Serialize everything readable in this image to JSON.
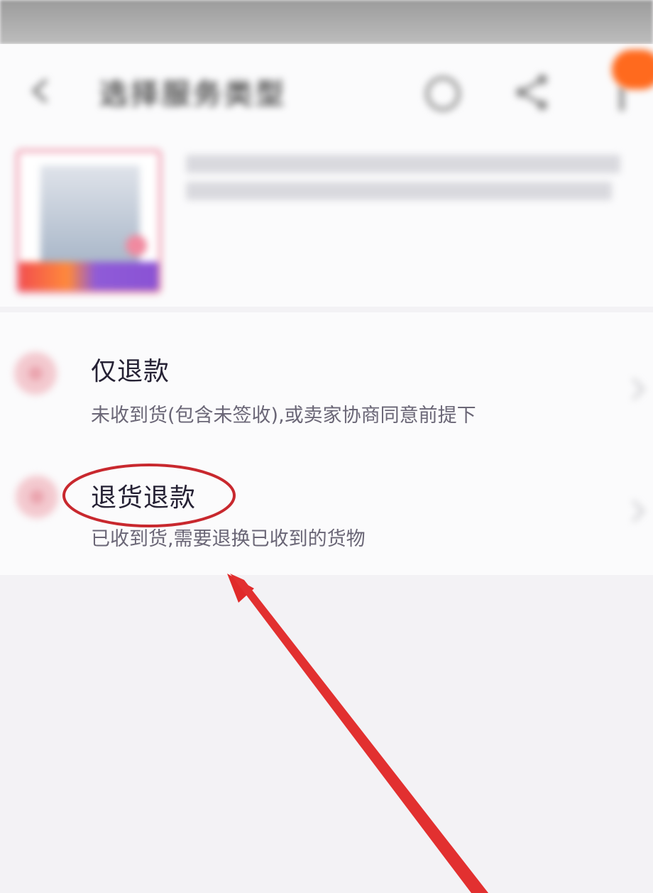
{
  "nav": {
    "title": "选择服务类型",
    "back_icon": "arrow-left-icon",
    "record_icon": "circle-icon",
    "share_icon": "share-icon",
    "more_icon": "more-icon"
  },
  "product": {
    "thumbnail": "product-thumbnail"
  },
  "options": [
    {
      "title": "仅退款",
      "description": "未收到货(包含未签收),或卖家协商同意前提下",
      "icon": "refund-icon"
    },
    {
      "title": "退货退款",
      "description": "已收到货,需要退换已收到的货物",
      "icon": "return-refund-icon"
    }
  ],
  "colors": {
    "annotation_red": "#e02a2a",
    "badge_orange": "#ff6a1e",
    "option_icon_pink": "#f3c9cf"
  }
}
